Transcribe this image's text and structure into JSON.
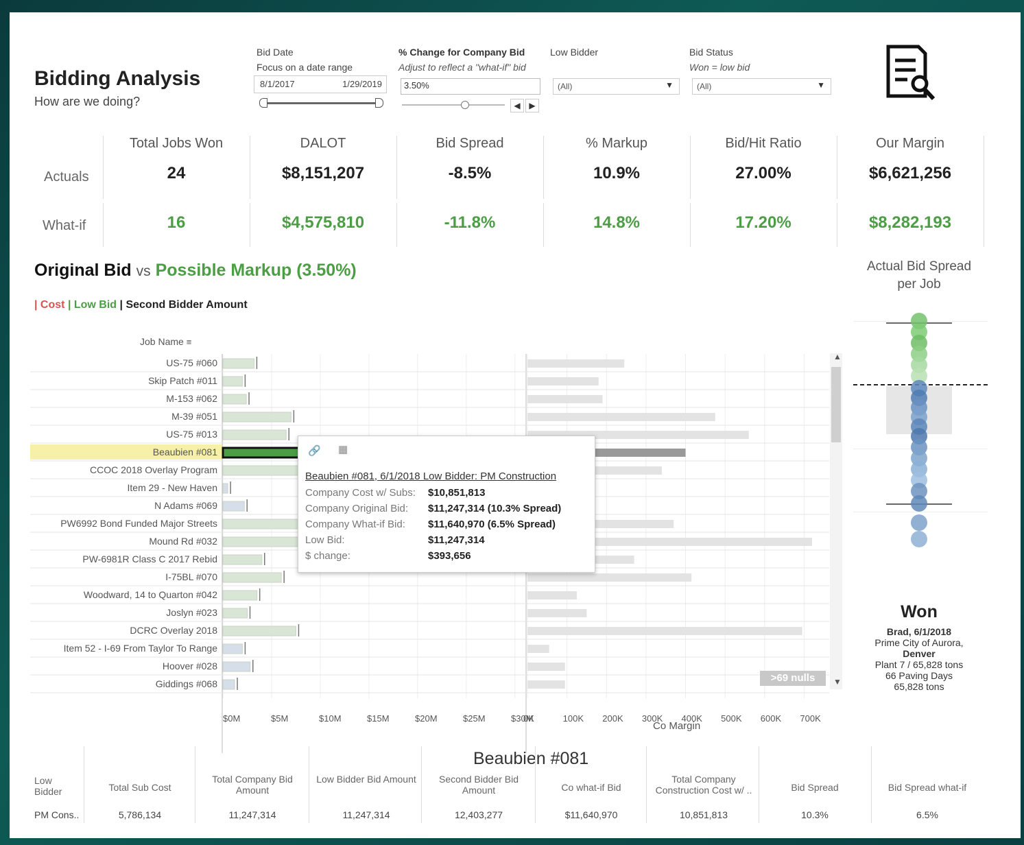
{
  "header": {
    "title": "Bidding Analysis",
    "subtitle": "How are we doing?"
  },
  "filters": {
    "bid_date": {
      "label": "Bid Date",
      "sub": "Focus on a date range",
      "start": "8/1/2017",
      "end": "1/29/2019"
    },
    "pct_change": {
      "label": "% Change for Company Bid",
      "sub": "Adjust to reflect a \"what-if\" bid",
      "value": "3.50%"
    },
    "low_bidder": {
      "label": "Low Bidder",
      "value": "(All)"
    },
    "bid_status": {
      "label": "Bid Status",
      "sub": "Won = low bid",
      "value": "(All)"
    }
  },
  "kpis": {
    "row_labels": [
      "Actuals",
      "What-if"
    ],
    "columns": [
      {
        "head": "Total Jobs Won",
        "actual": "24",
        "whatif": "16"
      },
      {
        "head": "DALOT",
        "actual": "$8,151,207",
        "whatif": "$4,575,810"
      },
      {
        "head": "Bid Spread",
        "actual": "-8.5%",
        "whatif": "-11.8%"
      },
      {
        "head": "% Markup",
        "actual": "10.9%",
        "whatif": "14.8%"
      },
      {
        "head": "Bid/Hit Ratio",
        "actual": "27.00%",
        "whatif": "17.20%"
      },
      {
        "head": "Our Margin",
        "actual": "$6,621,256",
        "whatif": "$8,282,193"
      }
    ]
  },
  "section": {
    "title_a": "Original Bid",
    "title_vs": "vs",
    "title_b": "Possible Markup (3.50%)",
    "legend_cost": "| Cost",
    "legend_low": "| Low Bid",
    "legend_second": "| Second Bidder Amount",
    "job_name_header": "Job Name",
    "nulls_badge": ">69 nulls",
    "co_margin_label": "Co Margin",
    "right_title_1": "Actual Bid Spread",
    "right_title_2": "per Job"
  },
  "colors": {
    "green": "#4c9e45",
    "red": "#d9534f",
    "highlight": "#f6f0a8",
    "bar_gray": "#e3e3e3",
    "bar_green": "#d9e6d6",
    "bar_blue": "#d6dfe9"
  },
  "chart_data": {
    "type": "bar",
    "categories": [
      "US-75 #060",
      "Skip Patch #011",
      "M-153 #062",
      "M-39 #051",
      "US-75 #013",
      "Beaubien #081",
      "CCOC 2018 Overlay Program",
      "Item 29 - New Haven",
      "N Adams #069",
      "PW6992 Bond Funded Major Streets",
      "Mound Rd #032",
      "PW-6981R Class C 2017 Rebid",
      "I-75BL #070",
      "Woodward, 14 to Quarton #042",
      "Joslyn #023",
      "DCRC Overlay 2018",
      "Item 52 - I-69 From Taylor To Range",
      "Hoover #028",
      "Giddings #068"
    ],
    "series": [
      {
        "values": [
          3.2,
          2.0,
          2.4,
          7.0,
          6.5,
          11.2,
          9.0,
          0.5,
          2.2,
          12.0,
          12.0,
          4.0,
          6.0,
          3.5,
          2.5,
          7.5,
          2.0,
          2.8,
          1.2
        ]
      }
    ],
    "co_margin": [
      245000,
      180000,
      190000,
      475000,
      560000,
      400000,
      340000,
      0,
      0,
      370000,
      720000,
      270000,
      415000,
      125000,
      150000,
      695000,
      55000,
      95000,
      95000
    ],
    "xlim_bid": [
      0,
      31
    ],
    "xlim_margin": [
      0,
      760000
    ],
    "x_ticks_bid": [
      "$0M",
      "$5M",
      "$10M",
      "$15M",
      "$20M",
      "$25M",
      "$30M"
    ],
    "x_ticks_margin": [
      "0K",
      "100K",
      "200K",
      "300K",
      "400K",
      "500K",
      "600K",
      "700K"
    ],
    "xlabel": "Co Margin"
  },
  "tooltip": {
    "title": "Beaubien #081, 6/1/2018 Low Bidder: PM Construction",
    "rows": [
      {
        "label": "Company Cost w/ Subs:",
        "value": "$10,851,813"
      },
      {
        "label": "Company Original Bid:",
        "value": "$11,247,314 (10.3% Spread)"
      },
      {
        "label": "Company What-if Bid:",
        "value": "$11,640,970 (6.5% Spread)"
      },
      {
        "label": "Low Bid:",
        "value": "$11,247,314"
      },
      {
        "label": "$ change:",
        "value": "$393,656"
      }
    ]
  },
  "won_panel": {
    "heading": "Won",
    "line1": "Brad, 6/1/2018",
    "line2": "Prime City of Aurora,",
    "line3": "Denver",
    "line4": "Plant 7 / 65,828 tons",
    "line5": "66 Paving Days",
    "line6": "65,828 tons"
  },
  "detail": {
    "job": "Beaubien #081",
    "headers": [
      "Low Bidder",
      "Total Sub Cost",
      "Total Company Bid Amount",
      "Low Bidder Bid Amount",
      "Second Bidder Bid Amount",
      "Co what-if Bid",
      "Total Company Construction Cost w/ ..",
      "Bid Spread",
      "Bid Spread what-if"
    ],
    "values": [
      "PM Cons..",
      "5,786,134",
      "11,247,314",
      "11,247,314",
      "12,403,277",
      "$11,640,970",
      "10,851,813",
      "10.3%",
      "6.5%"
    ]
  }
}
